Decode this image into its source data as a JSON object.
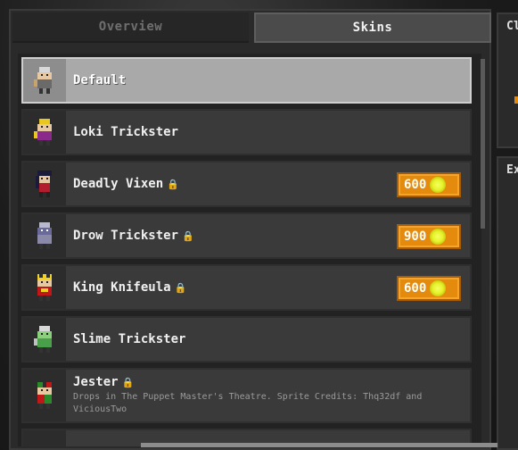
{
  "tabs": [
    {
      "label": "Overview",
      "active": false
    },
    {
      "label": "Skins",
      "active": true
    }
  ],
  "skins": [
    {
      "name": "Default",
      "locked": false,
      "selected": true,
      "price": null,
      "icon": "rogue-default-sprite"
    },
    {
      "name": "Loki Trickster",
      "locked": false,
      "selected": false,
      "price": null,
      "icon": "loki-trickster-sprite"
    },
    {
      "name": "Deadly Vixen",
      "locked": true,
      "selected": false,
      "price": "600",
      "icon": "deadly-vixen-sprite"
    },
    {
      "name": "Drow Trickster",
      "locked": true,
      "selected": false,
      "price": "900",
      "icon": "drow-trickster-sprite"
    },
    {
      "name": "King Knifeula",
      "locked": true,
      "selected": false,
      "price": "600",
      "icon": "king-knifeula-sprite"
    },
    {
      "name": "Slime Trickster",
      "locked": false,
      "selected": false,
      "price": null,
      "icon": "slime-trickster-sprite"
    },
    {
      "name": "Jester",
      "locked": true,
      "selected": false,
      "price": null,
      "icon": "jester-sprite",
      "description_line1": "Drops in The Puppet Master's Theatre. Sprite Credits: Thq32df and",
      "description_line2": "ViciousTwo"
    }
  ],
  "side": {
    "top_label": "Cl",
    "bottom_label": "Ex"
  },
  "colors": {
    "price_bg": "#e48a0c",
    "coin": "#e6f22a",
    "selected_row": "#a9a9a9"
  }
}
